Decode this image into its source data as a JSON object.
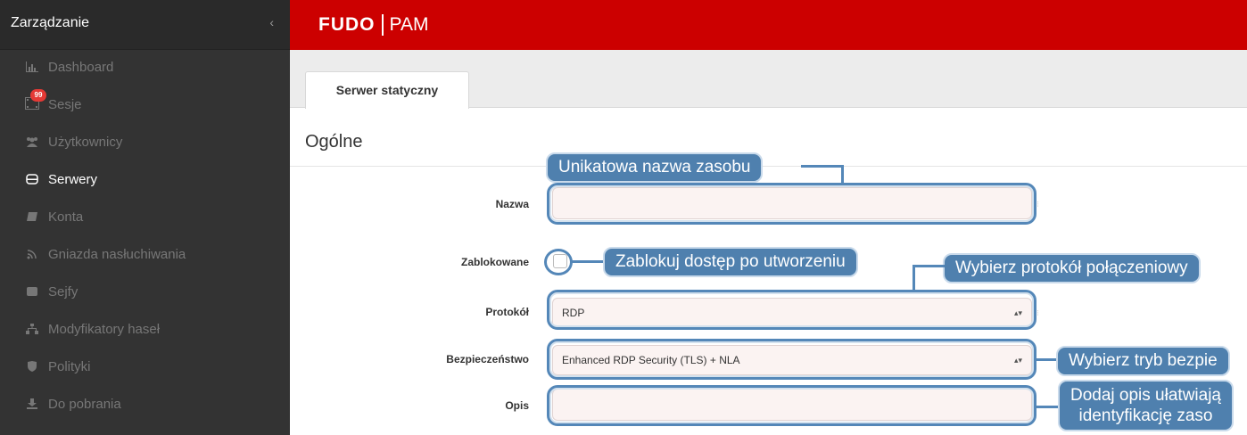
{
  "sidebar": {
    "title": "Zarządzanie",
    "collapse_icon": "chevron-left-icon",
    "items": [
      {
        "label": "Dashboard",
        "icon": "chart-icon"
      },
      {
        "label": "Sesje",
        "icon": "film-icon",
        "badge": "99"
      },
      {
        "label": "Użytkownicy",
        "icon": "users-icon"
      },
      {
        "label": "Serwery",
        "icon": "server-icon"
      },
      {
        "label": "Konta",
        "icon": "account-icon"
      },
      {
        "label": "Gniazda nasłuchiwania",
        "icon": "rss-icon"
      },
      {
        "label": "Sejfy",
        "icon": "safe-icon"
      },
      {
        "label": "Modyfikatory haseł",
        "icon": "sitemap-icon"
      },
      {
        "label": "Polityki",
        "icon": "shield-icon"
      },
      {
        "label": "Do pobrania",
        "icon": "download-icon"
      }
    ]
  },
  "header": {
    "logo_main": "FUDO",
    "logo_product": "PAM"
  },
  "tabs": [
    {
      "label": "Serwer statyczny"
    }
  ],
  "section": {
    "title": "Ogólne"
  },
  "form": {
    "name_label": "Nazwa",
    "name_value": "",
    "blocked_label": "Zablokowane",
    "protocol_label": "Protokół",
    "protocol_value": "RDP",
    "security_label": "Bezpieczeństwo",
    "security_value": "Enhanced RDP Security (TLS) + NLA",
    "description_label": "Opis",
    "description_value": ""
  },
  "callouts": {
    "name": "Unikatowa nazwa zasobu",
    "blocked": "Zablokuj dostęp po utworzeniu",
    "protocol": "Wybierz protokół połączeniowy",
    "security": "Wybierz tryb bezpie",
    "description_line1": "Dodaj opis ułatwiają",
    "description_line2": "identyfikację zaso"
  },
  "colors": {
    "topbar": "#cc0000",
    "sidebar": "#333333",
    "callout": "#4f80ae",
    "input_bg": "#fbf3f2"
  }
}
